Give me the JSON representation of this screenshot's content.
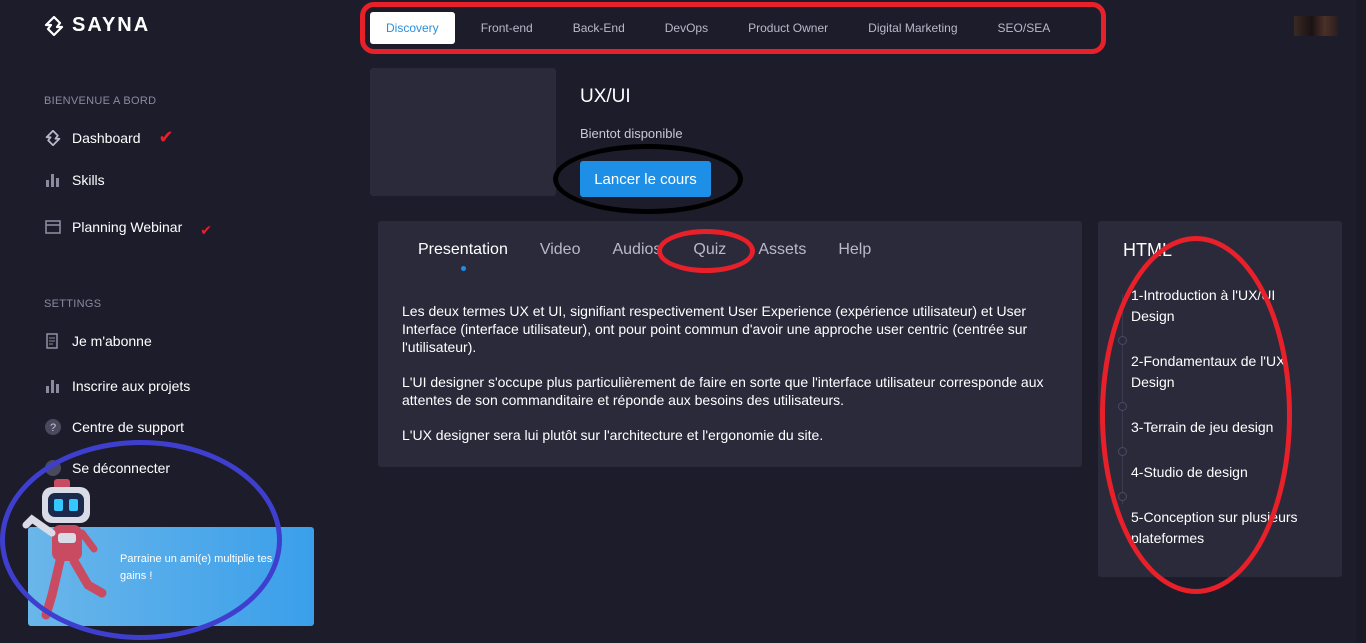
{
  "brand": {
    "name": "SAYNA"
  },
  "topnav": {
    "tabs": [
      {
        "label": "Discovery",
        "active": true
      },
      {
        "label": "Front-end"
      },
      {
        "label": "Back-End"
      },
      {
        "label": "DevOps"
      },
      {
        "label": "Product Owner"
      },
      {
        "label": "Digital Marketing"
      },
      {
        "label": "SEO/SEA"
      }
    ]
  },
  "sidebar": {
    "section1": "BIENVENUE A BORD",
    "section2": "SETTINGS",
    "items": {
      "dashboard": "Dashboard",
      "skills": "Skills",
      "planning": "Planning Webinar",
      "subscribe": "Je m'abonne",
      "projects": "Inscrire aux projets",
      "support": "Centre de support",
      "logout": "Se déconnecter"
    },
    "promo": "Parraine un ami(e) multiplie tes gains !"
  },
  "course": {
    "title": "UX/UI",
    "status": "Bientot disponible",
    "launch_label": "Lancer le cours"
  },
  "content_tabs": [
    "Presentation",
    "Video",
    "Audios",
    "Quiz",
    "Assets",
    "Help"
  ],
  "description": [
    "Les deux termes UX et UI, signifiant respectivement User Experience (expérience utilisateur) et User Interface (interface utilisateur), ont pour point commun d'avoir une approche user centric (centrée sur l'utilisateur).",
    "L'UI designer s'occupe plus particulièrement de faire en sorte que l'interface utilisateur corresponde aux attentes de son commanditaire et réponde aux besoins des utilisateurs.",
    "L'UX designer sera lui plutôt sur l'architecture et l'ergonomie du site."
  ],
  "toc": {
    "title": "HTML",
    "items": [
      "1-Introduction à l'UX/UI Design",
      "2-Fondamentaux de l'UX Design",
      "3-Terrain de jeu design",
      "4-Studio de design",
      "5-Conception sur plusieurs plateformes"
    ]
  },
  "colors": {
    "background": "#1d1c2b",
    "card": "#2a2a3b",
    "accent": "#1e8fe6",
    "annotation_red": "#e8202a",
    "annotation_blue": "#3f3fcf"
  }
}
